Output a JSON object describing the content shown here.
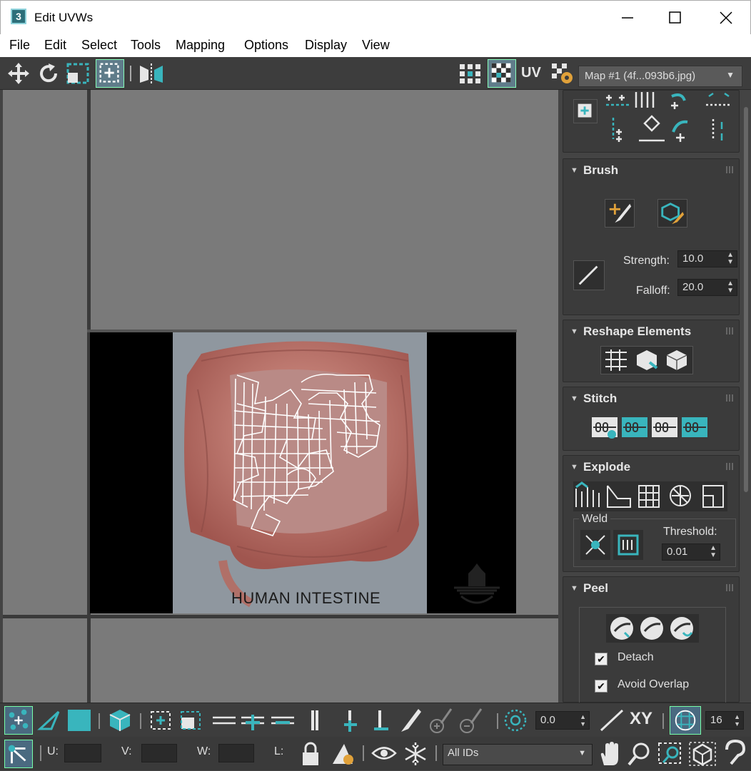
{
  "window": {
    "title": "Edit UVWs",
    "icon_label": "3"
  },
  "menu": [
    "File",
    "Edit",
    "Select",
    "Tools",
    "Mapping",
    "Options",
    "Display",
    "View"
  ],
  "toolbar": {
    "uv_label": "UV",
    "map_select": "Map #1 (4f...093b6.jpg)"
  },
  "texture": {
    "caption": "HUMAN INTESTINE"
  },
  "panel": {
    "brush": {
      "title": "Brush",
      "strength_label": "Strength:",
      "strength_value": "10.0",
      "falloff_label": "Falloff:",
      "falloff_value": "20.0"
    },
    "reshape": {
      "title": "Reshape Elements"
    },
    "stitch": {
      "title": "Stitch"
    },
    "explode": {
      "title": "Explode",
      "weld_label": "Weld",
      "threshold_label": "Threshold:",
      "threshold_value": "0.01"
    },
    "peel": {
      "title": "Peel",
      "detach_label": "Detach",
      "avoid_overlap_label": "Avoid Overlap",
      "detach_checked": true,
      "avoid_checked": true
    }
  },
  "bottom": {
    "rotate_value": "0.0",
    "xy_label": "XY",
    "grid_value": "16",
    "u_label": "U:",
    "v_label": "V:",
    "w_label": "W:",
    "l_label": "L:",
    "ids_select": "All IDs"
  },
  "colors": {
    "accent": "#39b5bd",
    "panel": "#3b3b3b",
    "viewport": "#7a7a7a"
  }
}
